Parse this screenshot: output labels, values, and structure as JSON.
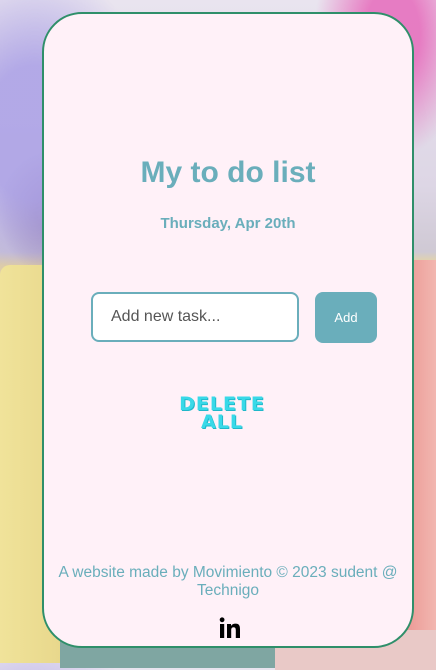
{
  "page": {
    "title": "My to do list",
    "date": "Thursday, Apr 20th"
  },
  "task_form": {
    "input_value": "",
    "input_placeholder": "Add new task...",
    "add_label": "Add"
  },
  "actions": {
    "delete_all_line1": "DELETE",
    "delete_all_line2": "ALL"
  },
  "footer": {
    "credit": "A website made by Movimiento © 2023 sudent @ Technigo",
    "social_icon": "linkedin-icon"
  },
  "colors": {
    "accent": "#6aaebb",
    "card_background": "#fff1f8",
    "card_border": "#2f8f6a",
    "delete_all": "#38d9e8"
  }
}
